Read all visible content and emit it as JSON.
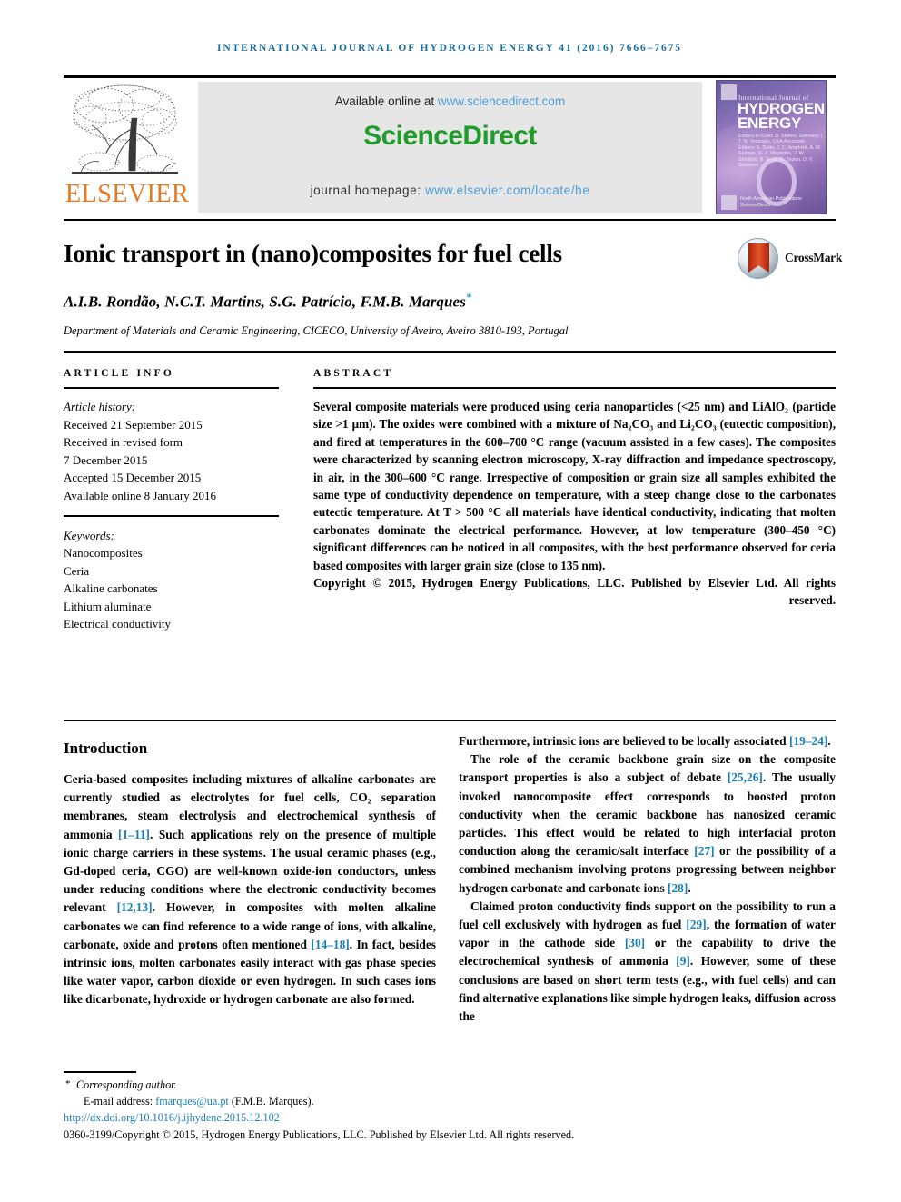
{
  "running_head": "International Journal of Hydrogen Energy 41 (2016) 7666–7675",
  "masthead": {
    "publisher_name": "ELSEVIER",
    "available_prefix": "Available online at ",
    "available_url": "www.sciencedirect.com",
    "logo_part1": "Science",
    "logo_part2": "Direct",
    "homepage_prefix": "journal homepage: ",
    "homepage_url": "www.elsevier.com/locate/he",
    "cover": {
      "kicker": "International Journal of",
      "line1": "HYDROGEN",
      "line2": "ENERGY",
      "editors": "Editors-in-Chief: D. Stolten, Germany  |  T. N. Veziroglu, USA\nAssociate Editors: S. Dutta, J. C. Amphlett, A. M. Kannan,\nM. Z. Moysides, J. W. Sheffield,\nB. Ernst, E. Taylan, D. Y. Goswami",
      "footer": "North American Publications\nScienceDirect"
    }
  },
  "article": {
    "title": "Ionic transport in (nano)composites for fuel cells",
    "crossmark_label": "CrossMark",
    "authors": "A.I.B. Rondão, N.C.T. Martins, S.G. Patrício, F.M.B. Marques",
    "author_star": "*",
    "affiliation": "Department of Materials and Ceramic Engineering, CICECO, University of Aveiro, Aveiro 3810-193, Portugal"
  },
  "info": {
    "heading": "Article info",
    "history_label": "Article history:",
    "history": [
      "Received 21 September 2015",
      "Received in revised form",
      "7 December 2015",
      "Accepted 15 December 2015",
      "Available online 8 January 2016"
    ],
    "keywords_label": "Keywords:",
    "keywords": [
      "Nanocomposites",
      "Ceria",
      "Alkaline carbonates",
      "Lithium aluminate",
      "Electrical conductivity"
    ]
  },
  "abstract": {
    "heading": "Abstract",
    "body": "Several composite materials were produced using ceria nanoparticles (<25 nm) and LiAlO₂ (particle size >1 μm). The oxides were combined with a mixture of Na₂CO₃ and Li₂CO₃ (eutectic composition), and fired at temperatures in the 600–700 °C range (vacuum assisted in a few cases). The composites were characterized by scanning electron microscopy, X-ray diffraction and impedance spectroscopy, in air, in the 300–600 °C range. Irrespective of composition or grain size all samples exhibited the same type of conductivity dependence on temperature, with a steep change close to the carbonates eutectic temperature. At T > 500 °C all materials have identical conductivity, indicating that molten carbonates dominate the electrical performance. However, at low temperature (300–450 °C) significant differences can be noticed in all composites, with the best performance observed for ceria based composites with larger grain size (close to 135 nm).",
    "copyright": "Copyright © 2015, Hydrogen Energy Publications, LLC. Published by Elsevier Ltd. All rights reserved."
  },
  "introduction": {
    "heading": "Introduction",
    "left_paragraph_part1": "Ceria-based composites including mixtures of alkaline carbonates are currently studied as electrolytes for fuel cells, CO₂ separation membranes, steam electrolysis and electrochemical synthesis of ammonia ",
    "ref_1_11": "[1–11]",
    "left_paragraph_part2": ". Such applications rely on the presence of multiple ionic charge carriers in these systems. The usual ceramic phases (e.g., Gd-doped ceria, CGO) are well-known oxide-ion conductors, unless under reducing conditions where the electronic conductivity becomes relevant ",
    "ref_12_13": "[12,13]",
    "left_paragraph_part3": ". However, in composites with molten alkaline carbonates we can find reference to a wide range of ions, with alkaline, carbonate, oxide and protons often mentioned ",
    "ref_14_18": "[14–18]",
    "left_paragraph_part4": ". In fact, besides intrinsic ions, molten carbonates easily interact with gas phase species like water vapor, carbon dioxide or even hydrogen. In such cases ions like dicarbonate, hydroxide or hydrogen carbonate are also formed.",
    "right_p1_part1": "Furthermore, intrinsic ions are believed to be locally associated ",
    "ref_19_24": "[19–24]",
    "right_p1_part2": ".",
    "right_p2_part1": "The role of the ceramic backbone grain size on the composite transport properties is also a subject of debate ",
    "ref_25_26": "[25,26]",
    "right_p2_part2": ". The usually invoked nanocomposite effect corresponds to boosted proton conductivity when the ceramic backbone has nanosized ceramic particles. This effect would be related to high interfacial proton conduction along the ceramic/salt interface ",
    "ref_27": "[27]",
    "right_p2_part3": " or the possibility of a combined mechanism involving protons progressing between neighbor hydrogen carbonate and carbonate ions ",
    "ref_28": "[28]",
    "right_p2_part4": ".",
    "right_p3_part1": "Claimed proton conductivity finds support on the possibility to run a fuel cell exclusively with hydrogen as fuel ",
    "ref_29": "[29]",
    "right_p3_part2": ", the formation of water vapor in the cathode side ",
    "ref_30": "[30]",
    "right_p3_part3": " or the capability to drive the electrochemical synthesis of ammonia ",
    "ref_9": "[9]",
    "right_p3_part4": ". However, some of these conclusions are based on short term tests (e.g., with fuel cells) and can find alternative explanations like simple hydrogen leaks, diffusion across the"
  },
  "footer": {
    "corresponding_author": "Corresponding author.",
    "email_label": "E-mail address: ",
    "email": "fmarques@ua.pt",
    "email_suffix": " (F.M.B. Marques).",
    "doi": "http://dx.doi.org/10.1016/j.ijhydene.2015.12.102",
    "issn_line": "0360-3199/Copyright © 2015, Hydrogen Energy Publications, LLC. Published by Elsevier Ltd. All rights reserved."
  },
  "colors": {
    "running_head": "#1a6e9e",
    "link": "#1a7fb5",
    "sciencedirect_green": "#1f9c2a",
    "elsevier_orange": "#e87722",
    "band_gray": "#e6e6e6"
  }
}
